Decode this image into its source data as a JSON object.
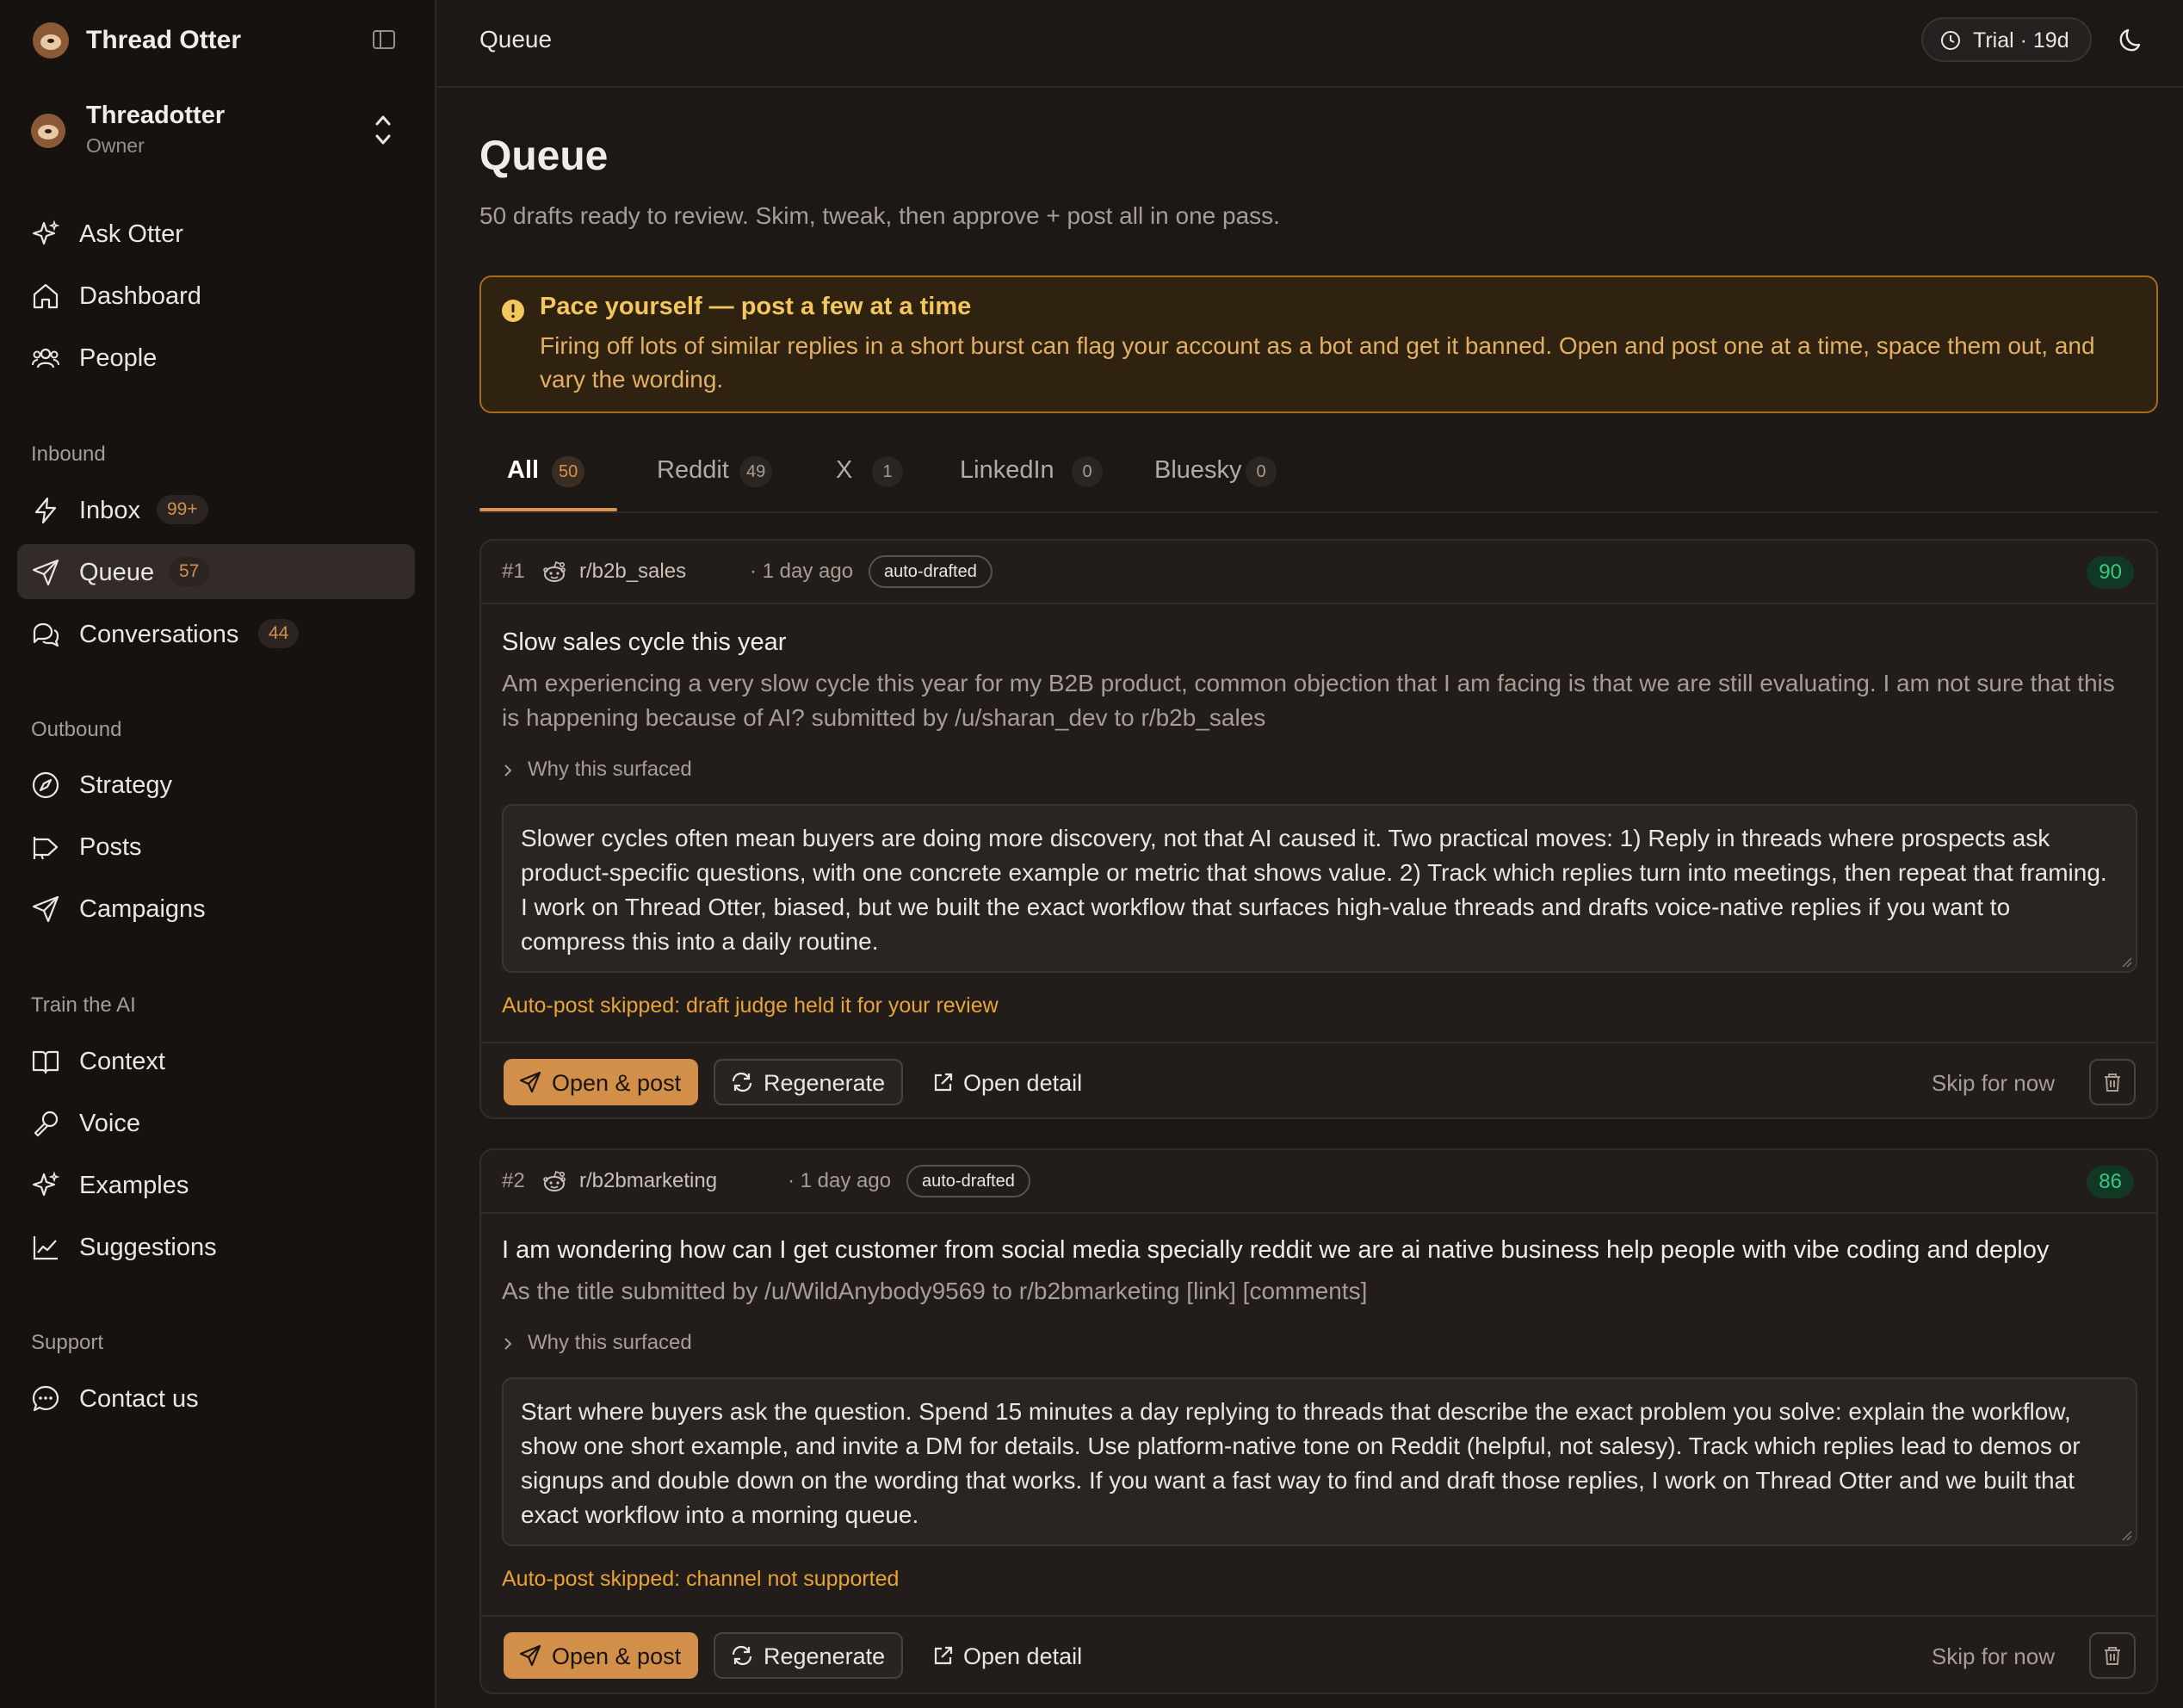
{
  "app": {
    "brand": "Thread Otter",
    "workspace": {
      "name": "Threadotter",
      "role": "Owner"
    }
  },
  "sidebar": {
    "top_items": [
      {
        "label": "Ask Otter",
        "icon": "sparkles-icon"
      },
      {
        "label": "Dashboard",
        "icon": "home-icon"
      },
      {
        "label": "People",
        "icon": "users-icon"
      }
    ],
    "sections": [
      {
        "label": "Inbound",
        "items": [
          {
            "label": "Inbox",
            "badge": "99+",
            "icon": "bolt-icon"
          },
          {
            "label": "Queue",
            "badge": "57",
            "icon": "send-icon",
            "active": true
          },
          {
            "label": "Conversations",
            "badge": "44",
            "icon": "chat-icon"
          }
        ]
      },
      {
        "label": "Outbound",
        "items": [
          {
            "label": "Strategy",
            "icon": "compass-icon"
          },
          {
            "label": "Posts",
            "icon": "megaphone-icon"
          },
          {
            "label": "Campaigns",
            "icon": "send-icon"
          }
        ]
      },
      {
        "label": "Train the AI",
        "items": [
          {
            "label": "Context",
            "icon": "book-icon"
          },
          {
            "label": "Voice",
            "icon": "microphone-icon"
          },
          {
            "label": "Examples",
            "icon": "sparkles-icon"
          },
          {
            "label": "Suggestions",
            "icon": "trend-chart-icon"
          }
        ]
      },
      {
        "label": "Support",
        "items": [
          {
            "label": "Contact us",
            "icon": "chat-bubble-icon"
          }
        ]
      }
    ]
  },
  "topbar": {
    "breadcrumb": "Queue",
    "trial": "Trial · 19d"
  },
  "page": {
    "title": "Queue",
    "subtitle": "50 drafts ready to review. Skim, tweak, then approve + post all in one pass."
  },
  "warning": {
    "title": "Pace yourself — post a few at a time",
    "body": "Firing off lots of similar replies in a short burst can flag your account as a bot and get it banned. Open and post one at a time, space them out, and vary the wording."
  },
  "tabs": [
    {
      "label": "All",
      "count": "50",
      "active": true
    },
    {
      "label": "Reddit",
      "count": "49"
    },
    {
      "label": "X",
      "count": "1"
    },
    {
      "label": "LinkedIn",
      "count": "0"
    },
    {
      "label": "Bluesky",
      "count": "0"
    }
  ],
  "cards": [
    {
      "num": "#1",
      "subreddit": "r/b2b_sales",
      "time": "· 1 day ago",
      "tag": "auto-drafted",
      "score": "90",
      "title": "Slow sales cycle this year",
      "body": "Am experiencing a very slow cycle this year for my B2B product, common objection that I am facing is that we are still evaluating. I am not sure that this is happening because of AI? submitted by /u/sharan_dev to r/b2b_sales",
      "why": "Why this surfaced",
      "draft": "Slower cycles often mean buyers are doing more discovery, not that AI caused it. Two practical moves: 1) Reply in threads where prospects ask product-specific questions, with one concrete example or metric that shows value. 2) Track which replies turn into meetings, then repeat that framing. I work on Thread Otter, biased, but we built the exact workflow that surfaces high-value threads and drafts voice-native replies if you want to compress this into a daily routine.",
      "skip_note": "Auto-post skipped: draft judge held it for your review"
    },
    {
      "num": "#2",
      "subreddit": "r/b2bmarketing",
      "time": "· 1 day ago",
      "tag": "auto-drafted",
      "score": "86",
      "title": "I am wondering how can I get customer from social media specially reddit we are ai native business help people with vibe coding and deploy",
      "body": "As the title submitted by /u/WildAnybody9569 to r/b2bmarketing [link] [comments]",
      "why": "Why this surfaced",
      "draft": "Start where buyers ask the question. Spend 15 minutes a day replying to threads that describe the exact problem you solve: explain the workflow, show one short example, and invite a DM for details. Use platform-native tone on Reddit (helpful, not salesy). Track which replies lead to demos or signups and double down on the wording that works. If you want a fast way to find and draft those replies, I work on Thread Otter and we built that exact workflow into a morning queue.",
      "skip_note": "Auto-post skipped: channel not supported"
    }
  ],
  "actions": {
    "open_post": "Open & post",
    "regenerate": "Regenerate",
    "open_detail": "Open detail",
    "skip": "Skip for now"
  },
  "colors": {
    "accent": "#d28f4a",
    "score_green": "#35c981",
    "warning_amber": "#f3c65e",
    "background": "#1c1816",
    "sidebar": "#161210"
  }
}
